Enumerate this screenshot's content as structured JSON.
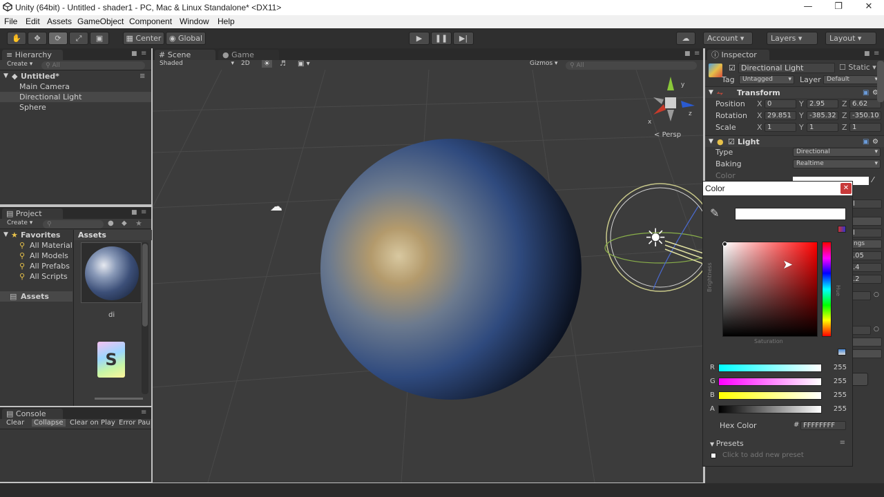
{
  "window": {
    "title": "Unity (64bit) - Untitled - shader1 - PC, Mac & Linux Standalone* <DX11>"
  },
  "menu": [
    "File",
    "Edit",
    "Assets",
    "GameObject",
    "Component",
    "Window",
    "Help"
  ],
  "toolbar": {
    "center": "Center",
    "global": "Global",
    "account": "Account",
    "layers": "Layers",
    "layout": "Layout"
  },
  "hierarchy": {
    "tab": "Hierarchy",
    "create": "Create",
    "search": "All",
    "scene": "Untitled*",
    "items": [
      "Main Camera",
      "Directional Light",
      "Sphere"
    ]
  },
  "project": {
    "tab": "Project",
    "create": "Create",
    "favorites": "Favorites",
    "fav_items": [
      "All Materials",
      "All Models",
      "All Prefabs",
      "All Scripts"
    ],
    "assets_root": "Assets",
    "assets_header": "Assets",
    "asset1_label": "di",
    "asset2_letter": "S"
  },
  "console": {
    "tab": "Console",
    "buttons": [
      "Clear",
      "Collapse",
      "Clear on Play",
      "Error Pau"
    ]
  },
  "scene_view": {
    "tab_scene": "Scene",
    "tab_game": "Game",
    "shading": "Shaded",
    "mode2d": "2D",
    "gizmos": "Gizmos",
    "search": "All",
    "persp": "Persp"
  },
  "inspector": {
    "tab": "Inspector",
    "object_name": "Directional Light",
    "static": "Static",
    "tag_label": "Tag",
    "tag_value": "Untagged",
    "layer_label": "Layer",
    "layer_value": "Default",
    "transform": "Transform",
    "position_label": "Position",
    "pos": {
      "x": "0",
      "y": "2.95",
      "z": "6.62"
    },
    "rotation_label": "Rotation",
    "rot": {
      "x": "29.851",
      "y": "-385.32",
      "z": "-350.10"
    },
    "scale_label": "Scale",
    "scl": {
      "x": "1",
      "y": "1",
      "z": "1"
    },
    "light": "Light",
    "type_label": "Type",
    "type_value": "Directional",
    "baking_label": "Baking",
    "baking_value": "Realtime",
    "color_label": "Color",
    "partial": [
      "l",
      "ngs",
      "l",
      ".05",
      ".4",
      ".2"
    ]
  },
  "color_picker": {
    "title": "Color",
    "saturation": "Saturation",
    "brightness": "Brightness",
    "hue": "Hue",
    "channels": [
      {
        "label": "R",
        "value": "255"
      },
      {
        "label": "G",
        "value": "255"
      },
      {
        "label": "B",
        "value": "255"
      },
      {
        "label": "A",
        "value": "255"
      }
    ],
    "hex_label": "Hex Color",
    "hex_hash": "#",
    "hex_value": "FFFFFFFF",
    "presets": "Presets",
    "add_preset": "Click to add new preset"
  }
}
